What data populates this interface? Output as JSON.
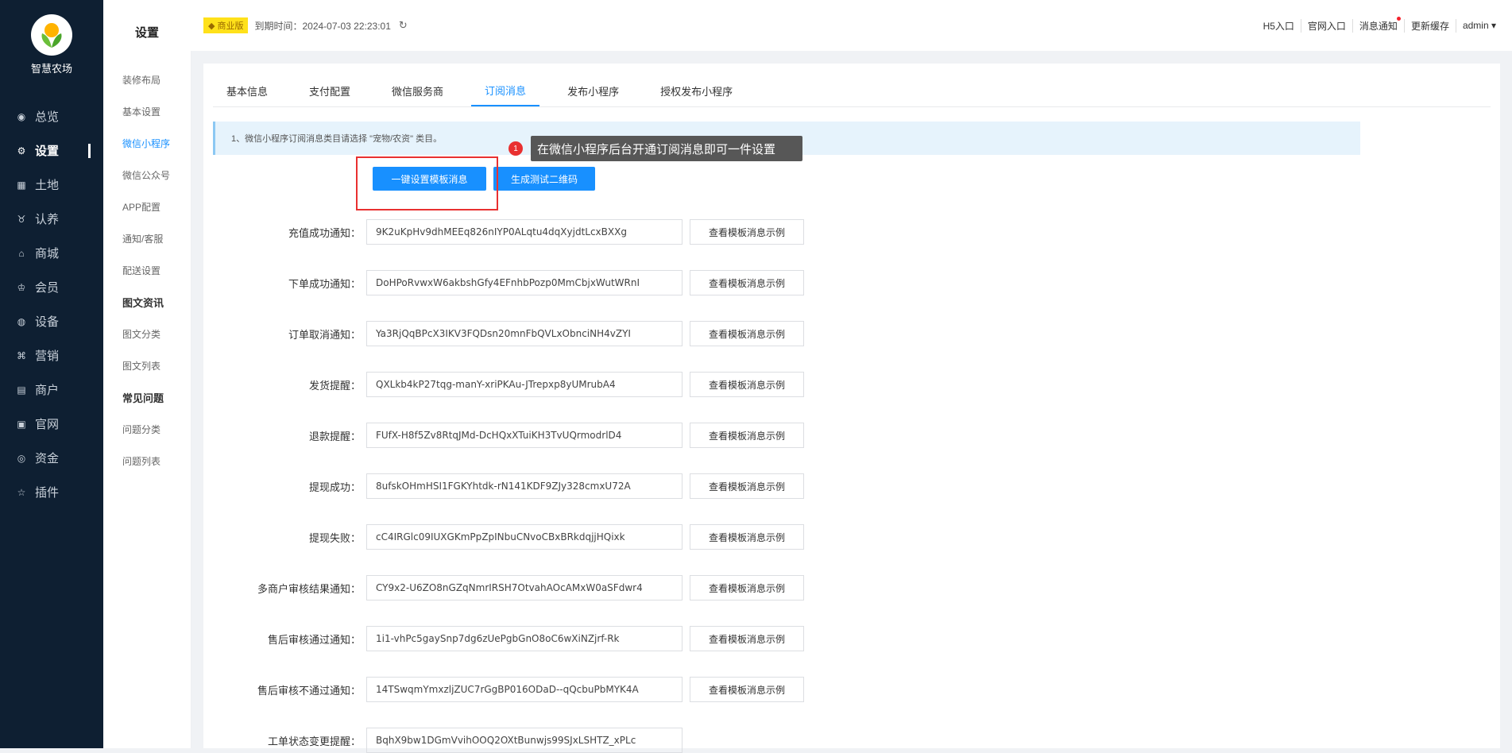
{
  "brand": {
    "name": "智慧农场"
  },
  "nav": [
    {
      "icon": "dashboard-icon",
      "glyph": "◉",
      "label": "总览"
    },
    {
      "icon": "gear-icon",
      "glyph": "⚙",
      "label": "设置",
      "active": true
    },
    {
      "icon": "grid-icon",
      "glyph": "▦",
      "label": "土地"
    },
    {
      "icon": "adopt-icon",
      "glyph": "♉",
      "label": "认养"
    },
    {
      "icon": "shop-icon",
      "glyph": "⌂",
      "label": "商城"
    },
    {
      "icon": "member-icon",
      "glyph": "♔",
      "label": "会员"
    },
    {
      "icon": "device-icon",
      "glyph": "◍",
      "label": "设备"
    },
    {
      "icon": "marketing-icon",
      "glyph": "⌘",
      "label": "营销"
    },
    {
      "icon": "merchant-icon",
      "glyph": "▤",
      "label": "商户"
    },
    {
      "icon": "website-icon",
      "glyph": "▣",
      "label": "官网"
    },
    {
      "icon": "funds-icon",
      "glyph": "◎",
      "label": "资金"
    },
    {
      "icon": "plugin-icon",
      "glyph": "☆",
      "label": "插件"
    }
  ],
  "subnav": {
    "title": "设置",
    "items": [
      {
        "label": "装修布局",
        "kind": "item"
      },
      {
        "label": "基本设置",
        "kind": "item"
      },
      {
        "label": "微信小程序",
        "kind": "active"
      },
      {
        "label": "微信公众号",
        "kind": "item"
      },
      {
        "label": "APP配置",
        "kind": "item"
      },
      {
        "label": "通知/客服",
        "kind": "item"
      },
      {
        "label": "配送设置",
        "kind": "item"
      },
      {
        "label": "图文资讯",
        "kind": "group"
      },
      {
        "label": "图文分类",
        "kind": "item"
      },
      {
        "label": "图文列表",
        "kind": "item"
      },
      {
        "label": "常见问题",
        "kind": "group"
      },
      {
        "label": "问题分类",
        "kind": "item"
      },
      {
        "label": "问题列表",
        "kind": "item"
      }
    ]
  },
  "topbar": {
    "badge": "商业版",
    "expire": "到期时间：2024-07-03 22:23:01",
    "links": [
      {
        "label": "H5入口",
        "name": "h5-entry-link"
      },
      {
        "label": "官网入口",
        "name": "website-entry-link"
      },
      {
        "label": "消息通知",
        "name": "notifications-link",
        "dot": true
      },
      {
        "label": "更新缓存",
        "name": "refresh-cache-link"
      },
      {
        "label": "admin ▾",
        "name": "admin-menu"
      }
    ]
  },
  "tabs": [
    {
      "label": "基本信息"
    },
    {
      "label": "支付配置"
    },
    {
      "label": "微信服务商"
    },
    {
      "label": "订阅消息",
      "active": true
    },
    {
      "label": "发布小程序"
    },
    {
      "label": "授权发布小程序"
    }
  ],
  "notice": "1、微信小程序订阅消息类目请选择 \"宠物/农资\" 类目。",
  "buttons": {
    "one_click": "一键设置模板消息",
    "qr": "生成测试二维码"
  },
  "tooltip": {
    "number": "1",
    "text": "在微信小程序后台开通订阅消息即可一件设置"
  },
  "view_label": "查看模板消息示例",
  "fields": [
    {
      "label": "充值成功通知：",
      "value": "9K2uKpHv9dhMEEq826nIYP0ALqtu4dqXyjdtLcxBXXg"
    },
    {
      "label": "下单成功通知：",
      "value": "DoHPoRvwxW6akbshGfy4EFnhbPozp0MmCbjxWutWRnI"
    },
    {
      "label": "订单取消通知：",
      "value": "Ya3RjQqBPcX3IKV3FQDsn20mnFbQVLxObnciNH4vZYI"
    },
    {
      "label": "发货提醒：",
      "value": "QXLkb4kP27tqg-manY-xriPKAu-JTrepxp8yUMrubA4"
    },
    {
      "label": "退款提醒：",
      "value": "FUfX-H8f5Zv8RtqJMd-DcHQxXTuiKH3TvUQrmodrlD4"
    },
    {
      "label": "提现成功：",
      "value": "8ufskOHmHSI1FGKYhtdk-rN141KDF9ZJy328cmxU72A"
    },
    {
      "label": "提现失败：",
      "value": "cC4IRGlc09IUXGKmPpZpINbuCNvoCBxBRkdqjjHQixk"
    },
    {
      "label": "多商户审核结果通知：",
      "value": "CY9x2-U6ZO8nGZqNmrIRSH7OtvahAOcAMxW0aSFdwr4"
    },
    {
      "label": "售后审核通过通知：",
      "value": "1i1-vhPc5gaySnp7dg6zUePgbGnO8oC6wXiNZjrf-Rk"
    },
    {
      "label": "售后审核不通过通知：",
      "value": "14TSwqmYmxzljZUC7rGgBP016ODaD--qQcbuPbMYK4A"
    },
    {
      "label": "工单状态变更提醒：",
      "value": "BqhX9bw1DGmVvihOOQ2OXtBunwjs99SJxLSHTZ_xPLc"
    }
  ]
}
